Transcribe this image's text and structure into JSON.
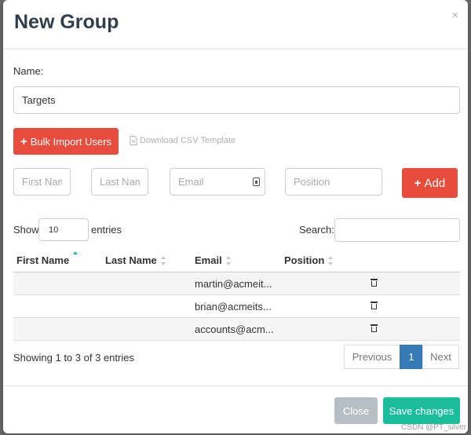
{
  "modal": {
    "title": "New Group",
    "close_glyph": "×",
    "name_label": "Name:",
    "name_value": "Targets",
    "bulk_import_label": "Bulk Import Users",
    "download_template_label": "Download CSV Template",
    "add_label": "Add",
    "placeholders": {
      "first_name": "First Name",
      "last_name": "Last Name",
      "email": "Email",
      "position": "Position"
    }
  },
  "table_controls": {
    "show_label": "Show",
    "entries_label": "entries",
    "page_size": "10",
    "search_label": "Search:",
    "search_value": ""
  },
  "table": {
    "columns": [
      "First Name",
      "Last Name",
      "Email",
      "Position"
    ],
    "rows": [
      {
        "first": "",
        "last": "",
        "email": "martin@acmeit...",
        "position": ""
      },
      {
        "first": "",
        "last": "",
        "email": "brian@acmeits...",
        "position": ""
      },
      {
        "first": "",
        "last": "",
        "email": "accounts@acm...",
        "position": ""
      }
    ]
  },
  "pagination": {
    "info": "Showing 1 to 3 of 3 entries",
    "previous": "Previous",
    "current": "1",
    "next": "Next"
  },
  "footer": {
    "close_label": "Close",
    "save_label": "Save changes"
  },
  "watermark": "CSDN @PT_silver",
  "icons": [
    "close-icon",
    "plus-icon",
    "file-icon",
    "contact-card-icon",
    "sort-icon",
    "trash-icon"
  ],
  "colors": {
    "danger": "#e74c3c",
    "success": "#1abc9c",
    "primary": "#337ab7",
    "muted_button": "#b8bfc4"
  }
}
